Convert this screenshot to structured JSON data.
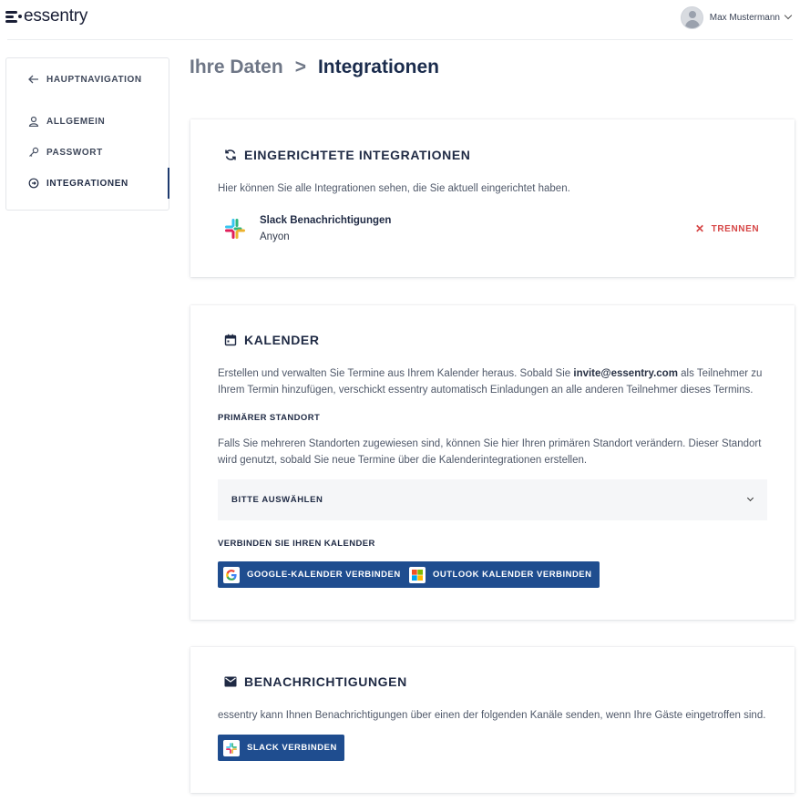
{
  "header": {
    "logo_text": "essentry",
    "user_name": "Max Mustermann"
  },
  "sidebar": {
    "items": [
      {
        "label": "HAUPTNAVIGATION",
        "icon": "arrow-left-icon"
      },
      {
        "label": "ALLGEMEIN",
        "icon": "user-icon"
      },
      {
        "label": "PASSWORT",
        "icon": "key-icon"
      },
      {
        "label": "INTEGRATIONEN",
        "icon": "integrations-icon",
        "active": true
      }
    ]
  },
  "breadcrumb": {
    "parent": "Ihre Daten",
    "separator": ">",
    "current": "Integrationen"
  },
  "installed": {
    "title": "EINGERICHTETE INTEGRATIONEN",
    "description": "Hier können Sie alle Integrationen sehen, die Sie aktuell eingerichtet haben.",
    "integration": {
      "name": "Slack Benachrichtigungen",
      "workspace": "Anyon",
      "disconnect_label": "TRENNEN"
    }
  },
  "calendar": {
    "title": "KALENDER",
    "description_1": "Erstellen und verwalten Sie Termine aus Ihrem Kalender heraus. Sobald Sie",
    "email": "invite@essentry.com",
    "description_2": "als Teilnehmer zu",
    "description_3": "Ihrem Termin hinzufügen, verschickt essentry automatisch Einladungen an alle anderen Teilnehmer dieses Termins.",
    "primary_location_heading": "PRIMÄRER STANDORT",
    "primary_location_text_1": "Falls Sie mehreren Standorten zugewiesen sind, können Sie hier Ihren primären Standort verändern. Dieser Standort",
    "primary_location_text_2": "wird genutzt, sobald Sie neue Termine über die Kalenderintegrationen erstellen.",
    "select_value": "BITTE AUSWÄHLEN",
    "connect_heading": "VERBINDEN SIE IHREN KALENDER",
    "google_button": "GOOGLE-KALENDER VERBINDEN",
    "outlook_button": "OUTLOOK KALENDER VERBINDEN"
  },
  "notifications": {
    "title": "BENACHRICHTIGUNGEN",
    "description": "essentry kann Ihnen Benachrichtigungen über einen der folgenden Kanäle senden, wenn Ihre Gäste eingetroffen sind.",
    "slack_button": "SLACK VERBINDEN"
  },
  "colors": {
    "primary_button": "#1f4d8f",
    "danger": "#d64545",
    "heading": "#1a2b4c"
  }
}
